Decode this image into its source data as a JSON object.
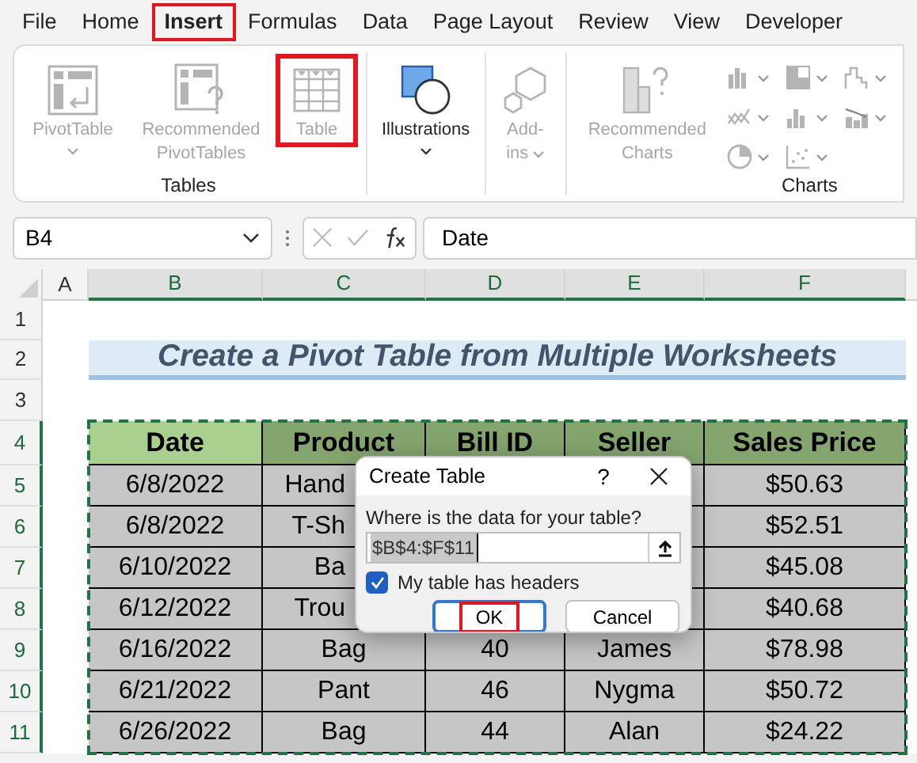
{
  "menu_tabs": [
    {
      "label": "File",
      "selected": false,
      "highlighted": false
    },
    {
      "label": "Home",
      "selected": false,
      "highlighted": false
    },
    {
      "label": "Insert",
      "selected": true,
      "highlighted": true
    },
    {
      "label": "Formulas",
      "selected": false,
      "highlighted": false
    },
    {
      "label": "Data",
      "selected": false,
      "highlighted": false
    },
    {
      "label": "Page Layout",
      "selected": false,
      "highlighted": false
    },
    {
      "label": "Review",
      "selected": false,
      "highlighted": false
    },
    {
      "label": "View",
      "selected": false,
      "highlighted": false
    },
    {
      "label": "Developer",
      "selected": false,
      "highlighted": false
    }
  ],
  "ribbon": {
    "groups": [
      {
        "kind": "buttons",
        "label": "Tables",
        "buttons": [
          {
            "kind": "pivot",
            "label": "PivotTable",
            "disabled": true,
            "dropdown": true,
            "highlighted": false
          },
          {
            "kind": "recpivot",
            "label": "Recommended PivotTables",
            "disabled": true,
            "dropdown": false,
            "highlighted": false
          },
          {
            "kind": "table",
            "label": "Table",
            "disabled": true,
            "dropdown": false,
            "highlighted": true
          }
        ]
      },
      {
        "kind": "buttons",
        "buttons": [
          {
            "kind": "shapes",
            "label": "Illustrations",
            "disabled": false,
            "dropdown": true,
            "highlighted": false
          }
        ]
      },
      {
        "kind": "buttons",
        "buttons": [
          {
            "kind": "addins",
            "label": "Add-ins",
            "disabled": true,
            "dropdown": true,
            "highlighted": false
          }
        ]
      },
      {
        "kind": "charts",
        "label": "Charts",
        "buttons": [
          {
            "kind": "recchart",
            "label": "Recommended Charts",
            "disabled": true,
            "dropdown": false,
            "highlighted": false
          }
        ]
      }
    ]
  },
  "formula_bar": {
    "name_box": "B4",
    "formula": "Date"
  },
  "columns": [
    {
      "label": "A",
      "selected": false
    },
    {
      "label": "B",
      "selected": true
    },
    {
      "label": "C",
      "selected": true
    },
    {
      "label": "D",
      "selected": true
    },
    {
      "label": "E",
      "selected": true
    },
    {
      "label": "F",
      "selected": true
    }
  ],
  "row_headers": [
    {
      "label": "1",
      "selected": false
    },
    {
      "label": "2",
      "selected": false
    },
    {
      "label": "3",
      "selected": false
    },
    {
      "label": "4",
      "selected": true
    },
    {
      "label": "5",
      "selected": true
    },
    {
      "label": "6",
      "selected": true
    },
    {
      "label": "7",
      "selected": true
    },
    {
      "label": "8",
      "selected": true
    },
    {
      "label": "9",
      "selected": true
    },
    {
      "label": "10",
      "selected": true
    },
    {
      "label": "11",
      "selected": true
    }
  ],
  "title": "Create a Pivot Table from Multiple Worksheets",
  "table": {
    "headers": [
      {
        "text": "Date",
        "active": true
      },
      {
        "text": "Product",
        "active": false
      },
      {
        "text": "Bill ID",
        "active": false
      },
      {
        "text": "Seller",
        "active": false
      },
      {
        "text": "Sales Price",
        "active": false
      }
    ],
    "rows": [
      [
        "6/8/2022",
        "Hand",
        null,
        null,
        "$50.63"
      ],
      [
        "6/8/2022",
        "T-Sh",
        null,
        null,
        "$52.51"
      ],
      [
        "6/10/2022",
        "Ba",
        null,
        null,
        "$45.08"
      ],
      [
        "6/12/2022",
        "Trou",
        null,
        null,
        "$40.68"
      ],
      [
        "6/16/2022",
        "Bag",
        "40",
        "James",
        "$78.98"
      ],
      [
        "6/21/2022",
        "Pant",
        "46",
        "Nygma",
        "$50.72"
      ],
      [
        "6/26/2022",
        "Bag",
        "44",
        "Alan",
        "$24.22"
      ]
    ]
  },
  "dialog": {
    "title": "Create Table",
    "help": "?",
    "prompt": "Where is the data for your table?",
    "range": "$B$4:$F$11",
    "checkbox": {
      "label": "My table has headers",
      "checked": true
    },
    "buttons": [
      {
        "label": "OK",
        "default": true,
        "highlighted": true
      },
      {
        "label": "Cancel",
        "default": false,
        "highlighted": false
      }
    ]
  }
}
